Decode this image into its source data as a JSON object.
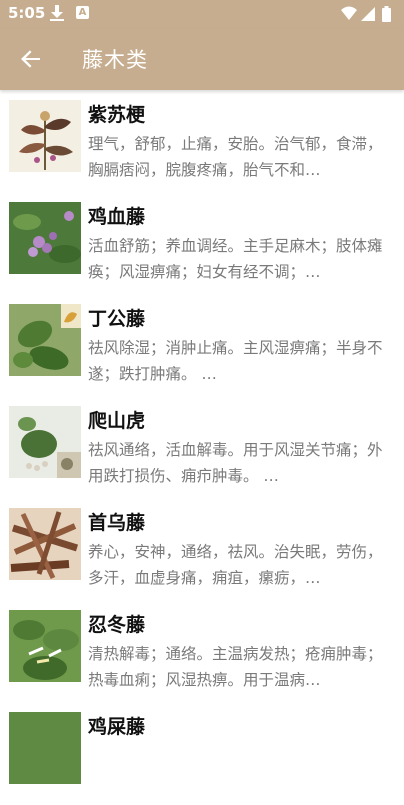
{
  "status_bar": {
    "time": "5:05",
    "a_icon_label": "A"
  },
  "app_bar": {
    "title": "藤木类"
  },
  "items": [
    {
      "name": "紫苏梗",
      "desc": "理气，舒郁，止痛，安胎。治气郁，食滞，胸膈痞闷，脘腹疼痛，胎气不和…",
      "thumb_icon": "plant-illustration"
    },
    {
      "name": "鸡血藤",
      "desc": "活血舒筋；养血调经。主手足麻木；肢体瘫痪；风湿痹痛；妇女有经不调；…",
      "thumb_icon": "purple-flower-photo"
    },
    {
      "name": "丁公藤",
      "desc": "祛风除湿；消肿止痛。主风湿痹痛；半身不遂；跌打肿痛。 …",
      "thumb_icon": "leaf-photo"
    },
    {
      "name": "爬山虎",
      "desc": "祛风通络，活血解毒。用于风湿关节痛；外用跌打损伤、痈疖肿毒。 …",
      "thumb_icon": "vine-photo"
    },
    {
      "name": "首乌藤",
      "desc": "养心，安神，通络，祛风。治失眠，劳伤，多汗，血虚身痛，痈疽，瘰疬，…",
      "thumb_icon": "dried-stems-photo"
    },
    {
      "name": "忍冬藤",
      "desc": "清热解毒；通络。主温病发热；疮痈肿毒；热毒血痢；风湿热痹。用于温病…",
      "thumb_icon": "honeysuckle-photo"
    },
    {
      "name": "鸡屎藤",
      "desc": "",
      "thumb_icon": "partial-photo"
    }
  ]
}
